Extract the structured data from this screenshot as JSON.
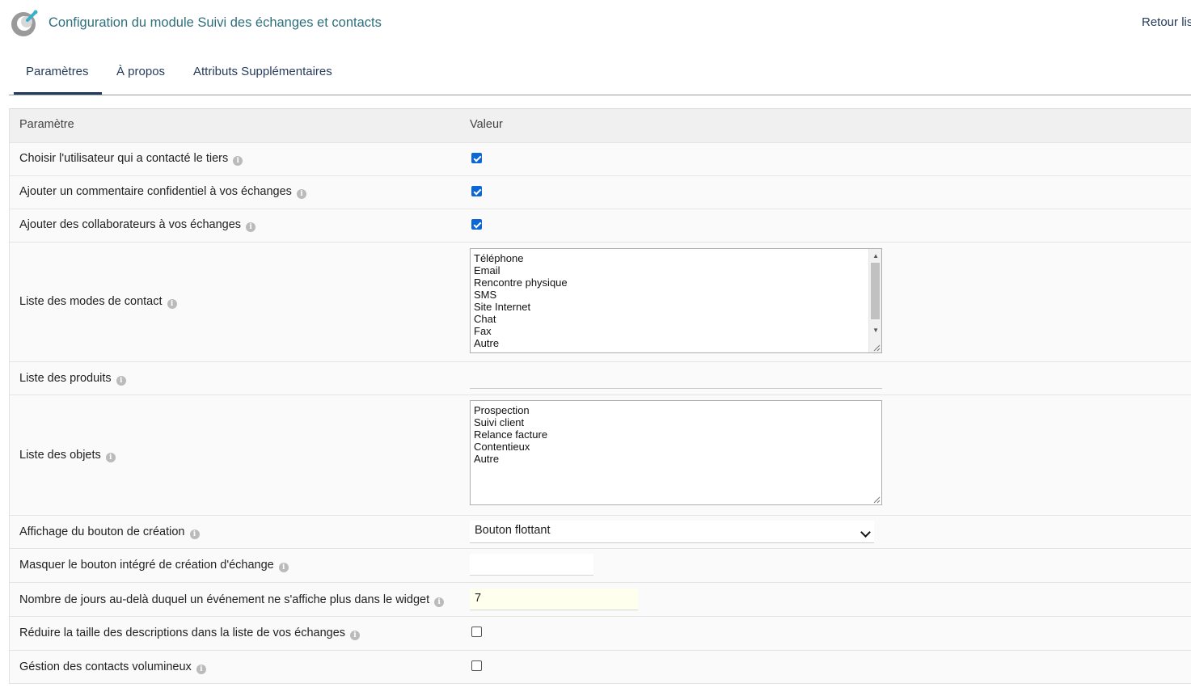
{
  "header": {
    "title": "Configuration du module Suivi des échanges et contacts",
    "back_label": "Retour lis",
    "logo_icon": "module-logo-icon"
  },
  "tabs": [
    {
      "label": "Paramètres",
      "active": true
    },
    {
      "label": "À propos",
      "active": false
    },
    {
      "label": "Attributs Supplémentaires",
      "active": false
    }
  ],
  "table": {
    "col_param": "Paramètre",
    "col_value": "Valeur",
    "rows": {
      "r1": {
        "label": "Choisir l'utilisateur qui a contacté le tiers",
        "checked": true
      },
      "r2": {
        "label": "Ajouter un commentaire confidentiel à vos échanges",
        "checked": true
      },
      "r3": {
        "label": "Ajouter des collaborateurs à vos échanges",
        "checked": true
      },
      "r4": {
        "label": "Liste des modes de contact",
        "options": [
          "Téléphone",
          "Email",
          "Rencontre physique",
          "SMS",
          "Site Internet",
          "Chat",
          "Fax",
          "Autre"
        ]
      },
      "r5": {
        "label": "Liste des produits",
        "value": ""
      },
      "r6": {
        "label": "Liste des objets",
        "options": [
          "Prospection",
          "Suivi client",
          "Relance facture",
          "Contentieux",
          "Autre"
        ]
      },
      "r7": {
        "label": "Affichage du bouton de création",
        "selected": "Bouton flottant"
      },
      "r8": {
        "label": "Masquer le bouton intégré de création d'échange",
        "value": ""
      },
      "r9": {
        "label": "Nombre de jours au-delà duquel un événement ne s'affiche plus dans le widget",
        "value": "7"
      },
      "r10": {
        "label": "Réduire la taille des descriptions dans la liste de vos échanges",
        "checked": false
      },
      "r11": {
        "label": "Géstion des contacts volumineux",
        "checked": false
      }
    }
  },
  "colors": {
    "accent": "#263c5c",
    "title": "#2e6f7d",
    "checkbox": "#0b66d6"
  }
}
